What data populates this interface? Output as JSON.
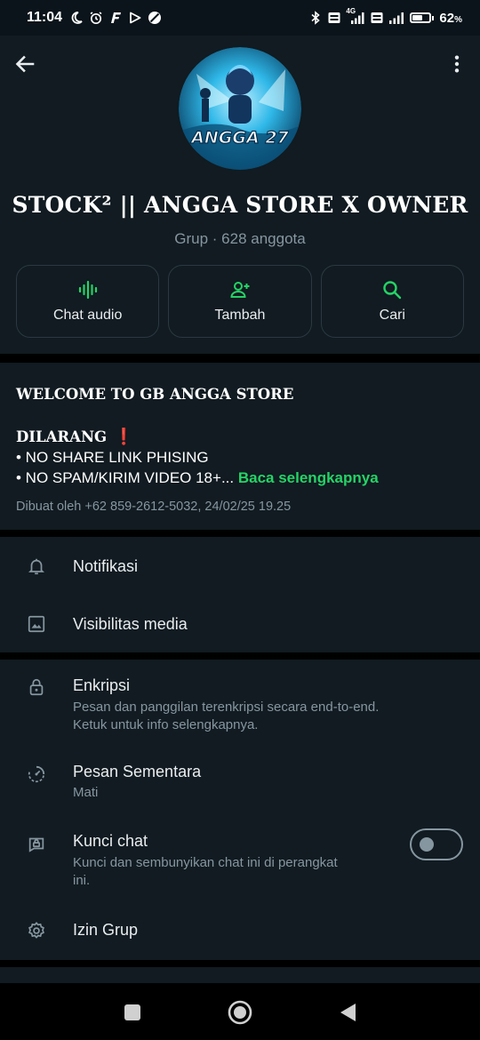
{
  "status_bar": {
    "time": "11:04",
    "battery_percent": "62",
    "battery_unit": "%",
    "battery_level": 0.62,
    "network_label_1": "4G",
    "icons": [
      "moon-icon",
      "alarm-icon",
      "f-app-icon",
      "play-icon",
      "ban-icon",
      "bluetooth-icon",
      "volte-icon",
      "signal-icon",
      "volte-icon",
      "signal-icon",
      "battery-icon"
    ]
  },
  "header": {
    "back_icon": "arrow-left-icon",
    "more_icon": "more-vertical-icon",
    "avatar_text": "ANGGA 27",
    "group_name": "STOCK² || ANGGA STORE X OWNER",
    "group_meta": "Grup · 628 anggota"
  },
  "actions": [
    {
      "label": "Chat audio",
      "icon": "audio-wave-icon"
    },
    {
      "label": "Tambah",
      "icon": "add-person-icon"
    },
    {
      "label": "Cari",
      "icon": "search-icon"
    }
  ],
  "description": {
    "title": "WELCOME TO GB ANGGA STORE",
    "subtitle": "DILARANG",
    "subtitle_mark": "❗",
    "line1": "• NO SHARE LINK PHISING",
    "line2": "• NO SPAM/KIRIM VIDEO 18+...",
    "read_more": "Baca selengkapnya",
    "created": "Dibuat oleh +62 859-2612-5032, 24/02/25 19.25"
  },
  "settings_top": [
    {
      "title": "Notifikasi",
      "icon": "bell-icon"
    },
    {
      "title": "Visibilitas media",
      "icon": "image-icon"
    }
  ],
  "settings_privacy": {
    "encryption": {
      "title": "Enkripsi",
      "subtitle_1": "Pesan dan panggilan terenkripsi secara end-to-end.",
      "subtitle_2": "Ketuk untuk info selengkapnya.",
      "icon": "lock-icon"
    },
    "disappearing": {
      "title": "Pesan Sementara",
      "subtitle": "Mati",
      "icon": "timer-icon"
    },
    "chat_lock": {
      "title": "Kunci chat",
      "subtitle_1": "Kunci dan sembunyikan chat ini di perangkat",
      "subtitle_2": "ini.",
      "icon": "chat-lock-icon",
      "enabled": false
    },
    "permissions": {
      "title": "Izin Grup",
      "icon": "gear-icon"
    }
  },
  "colors": {
    "background": "#111b21",
    "divider": "#000000",
    "accent": "#25d366",
    "primary_text": "#e9edef",
    "secondary_text": "#8696a0",
    "warning": "#e53935"
  },
  "nav": {
    "icons": [
      "recents-square-icon",
      "home-circle-icon",
      "back-triangle-icon"
    ]
  }
}
